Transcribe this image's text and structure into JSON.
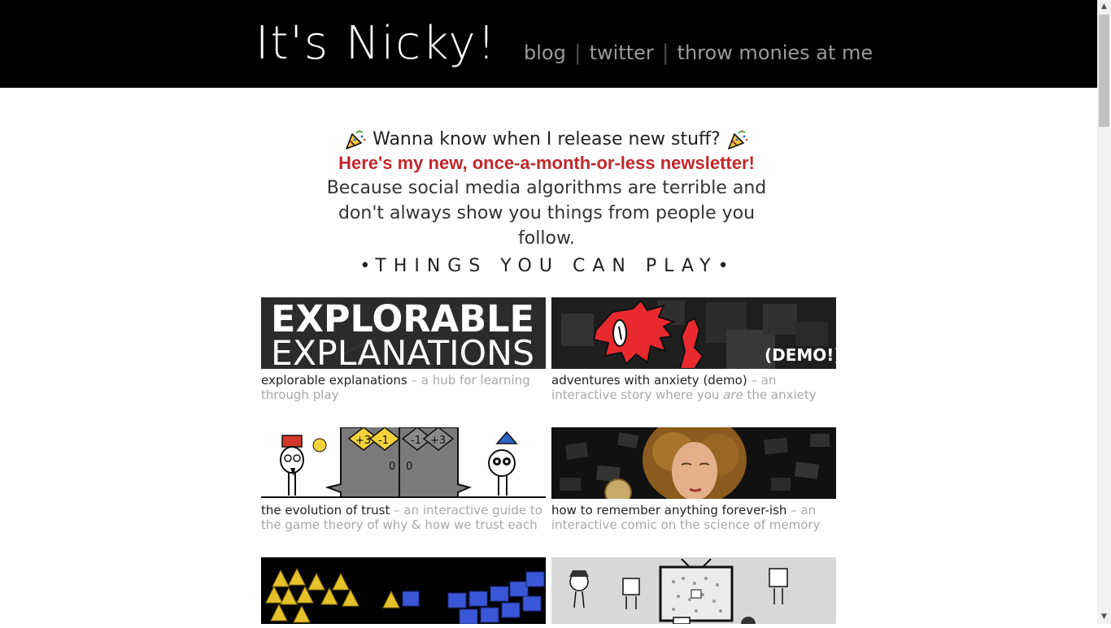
{
  "header": {
    "title": "It's Nicky!",
    "nav": [
      {
        "label": "blog"
      },
      {
        "label": "twitter"
      },
      {
        "label": "throw monies at me"
      }
    ],
    "nav_separator": "|"
  },
  "newsletter": {
    "headline": "Wanna know when I release new stuff?",
    "link_text": "Here's my new, once-a-month-or-less newsletter!",
    "body": "Because social media algorithms are terrible and don't always show you things from people you follow."
  },
  "section": {
    "bullet": "•",
    "title": "THINGS YOU CAN PLAY"
  },
  "cards": [
    {
      "name": "explorable explanations",
      "desc": " – a hub for learning through play",
      "thumb_text_1": "EXPLORABLE",
      "thumb_text_2": "EXPLANATIONS"
    },
    {
      "name": "adventures with anxiety (demo)",
      "desc_pre": " – an interactive story where you ",
      "desc_em": "are",
      "desc_post": " the anxiety",
      "thumb_text_1": "(DEMO!)"
    },
    {
      "name": "the evolution of trust",
      "desc": " – an interactive guide to the game theory of why & how we trust each other",
      "thumb_values": [
        "+3",
        "-1",
        "-1",
        "+3",
        "0",
        "0"
      ]
    },
    {
      "name": "how to remember anything forever-ish",
      "desc": " – an interactive comic on the science of memory"
    },
    {
      "name": "",
      "desc": ""
    },
    {
      "name": "",
      "desc": ""
    }
  ],
  "colors": {
    "header_bg": "#000000",
    "title": "#ffffff",
    "nav": "#9a9a9a",
    "newsletter_link": "#c0282d",
    "caption_name": "#222222",
    "caption_desc": "#a8a8a8",
    "anxiety_red": "#e8292e"
  },
  "icons": {
    "newsletter_left": "party-popper-icon",
    "newsletter_right": "party-popper-icon"
  }
}
